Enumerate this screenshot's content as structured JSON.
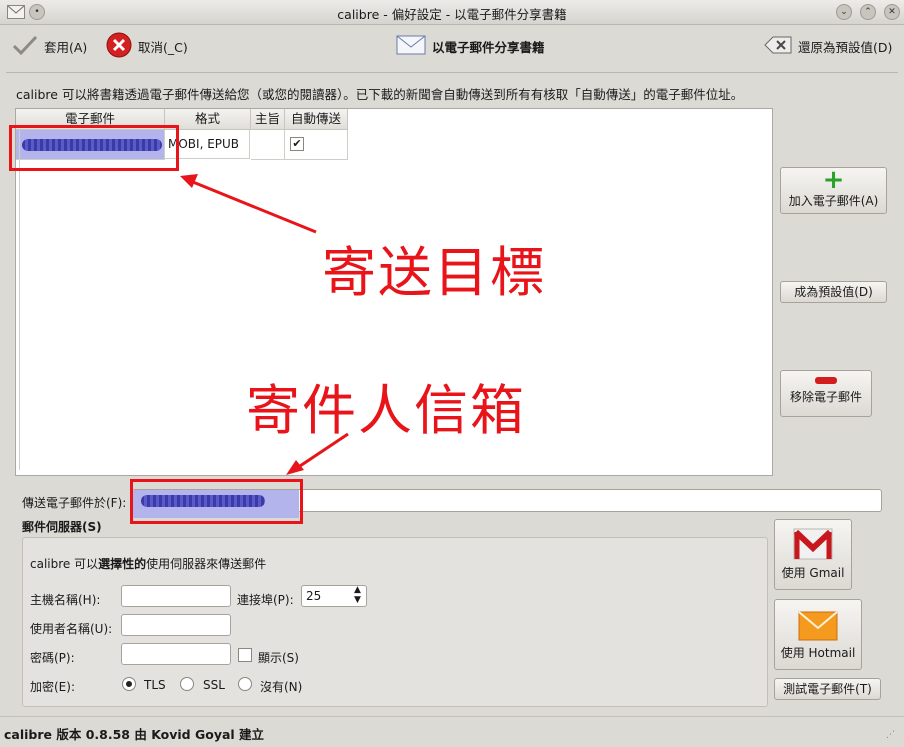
{
  "window": {
    "title": "calibre - 偏好設定 - 以電子郵件分享書籍"
  },
  "toolbar": {
    "apply_label": "套用(A)",
    "cancel_label": "取消(_C)",
    "section_title": "以電子郵件分享書籍",
    "restore_label": "還原為預設值(D)"
  },
  "info_text": "calibre 可以將書籍透過電子郵件傳送給您（或您的閱讀器）。已下載的新聞會自動傳送到所有有核取「自動傳送」的電子郵件位址。",
  "table": {
    "headers": [
      "電子郵件",
      "格式",
      "主旨",
      "自動傳送"
    ],
    "rows": [
      {
        "email": "",
        "formats": "MOBI, EPUB",
        "subject": "",
        "auto_send": true
      }
    ]
  },
  "side_buttons": {
    "add_email": "加入電子郵件(A)",
    "make_default": "成為預設值(D)",
    "remove_email": "移除電子郵件"
  },
  "annotations": {
    "target": "寄送目標",
    "sender": "寄件人信箱"
  },
  "send_from": {
    "label": "傳送電子郵件於(F):",
    "value": ""
  },
  "mail_server": {
    "group_title": "郵件伺服器(S)",
    "description_prefix": "calibre 可以",
    "description_bold": "選擇性的",
    "description_suffix": "使用伺服器來傳送郵件",
    "hostname_label": "主機名稱(H):",
    "hostname_value": "",
    "port_label": "連接埠(P):",
    "port_value": "25",
    "username_label": "使用者名稱(U):",
    "username_value": "",
    "password_label": "密碼(P):",
    "password_value": "",
    "show_label": "顯示(S)",
    "encryption_label": "加密(E):",
    "encryption_options": [
      "TLS",
      "SSL",
      "沒有(N)"
    ],
    "encryption_selected": "TLS"
  },
  "provider_buttons": {
    "gmail": "使用 Gmail",
    "hotmail": "使用 Hotmail",
    "test_email": "測試電子郵件(T)"
  },
  "footer": "calibre 版本 0.8.58 由 Kovid Goyal 建立",
  "colors": {
    "annotation_red": "#e8141a",
    "selection_blue": "#b4b4ec"
  }
}
